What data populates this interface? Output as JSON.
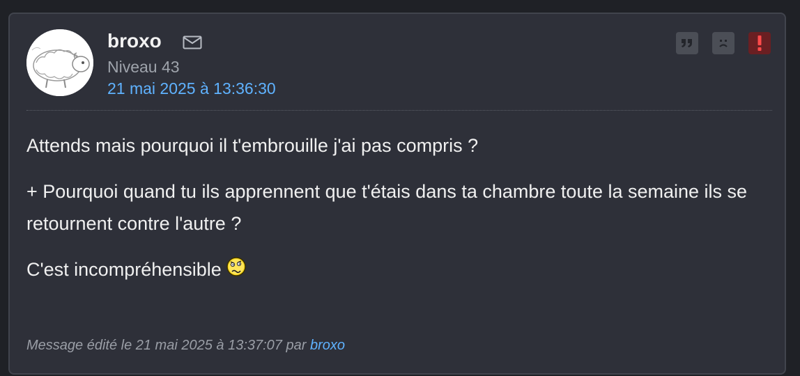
{
  "post": {
    "author": {
      "name": "broxo",
      "level": "Niveau 43",
      "avatar_icon": "sheep-avatar",
      "message_icon": "envelope-icon"
    },
    "date": "21 mai 2025 à 13:36:30",
    "actions": [
      {
        "name": "quote",
        "icon": "quote-icon"
      },
      {
        "name": "sad",
        "icon": "sad-face-icon"
      },
      {
        "name": "report",
        "icon": "exclamation-icon"
      }
    ],
    "content": {
      "paragraph1": "Attends mais pourquoi il t'embrouille j'ai pas compris ?",
      "paragraph2": "+ Pourquoi quand tu ils apprennent que t'étais dans ta chambre toute la semaine ils se retournent contre l'autre ?",
      "paragraph3": "C'est incompréhensible",
      "smiley_icon": "confused-smiley-icon"
    },
    "edit": {
      "prefix": "Message édité le 21 mai 2025 à 13:37:07 par",
      "author": "broxo"
    }
  },
  "colors": {
    "background": "#1f2126",
    "card": "#2e3039",
    "link": "#5fb2ff",
    "report": "#6a1f22"
  }
}
